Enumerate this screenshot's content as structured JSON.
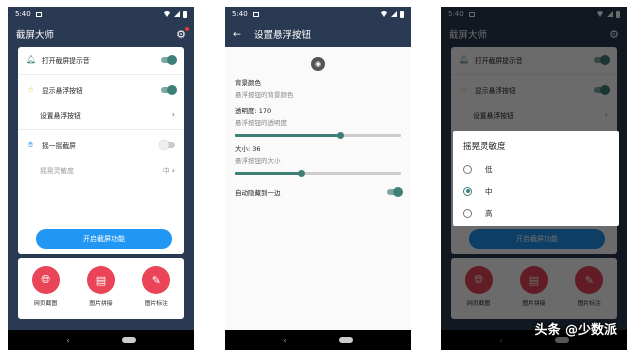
{
  "status": {
    "time": "5:40"
  },
  "screen1": {
    "title": "截屏大师",
    "items": {
      "sound": "打开截屏提示音",
      "float": "显示悬浮按钮",
      "float_settings": "设置悬浮按钮",
      "shake": "摇一摇截屏",
      "sensitivity": "摇晃灵敏度",
      "sensitivity_value": "中"
    },
    "start_button": "开启截屏功能",
    "tools": [
      {
        "label": "网页截图",
        "icon": "globe-icon"
      },
      {
        "label": "图片拼接",
        "icon": "stitch-icon"
      },
      {
        "label": "图片标注",
        "icon": "pencil-icon"
      }
    ]
  },
  "screen2": {
    "title": "设置悬浮按钮",
    "bg_color_label": "背景颜色",
    "bg_color_hint": "悬浮按钮的背景颜色",
    "opacity_label": "透明度: 170",
    "opacity_hint": "悬浮按钮的透明度",
    "opacity_fraction": 0.63,
    "size_label": "大小: 36",
    "size_hint": "悬浮按钮的大小",
    "size_fraction": 0.4,
    "autohide_label": "自动隐藏到一边"
  },
  "dialog": {
    "title": "摇晃灵敏度",
    "options": [
      "低",
      "中",
      "高"
    ],
    "selected": 1
  },
  "watermark": "头条 @少数派",
  "colors": {
    "accent": "#3e7f78",
    "primary": "#2196f3",
    "toolbar": "#2a3a52",
    "tool_circle": "#e94458"
  }
}
